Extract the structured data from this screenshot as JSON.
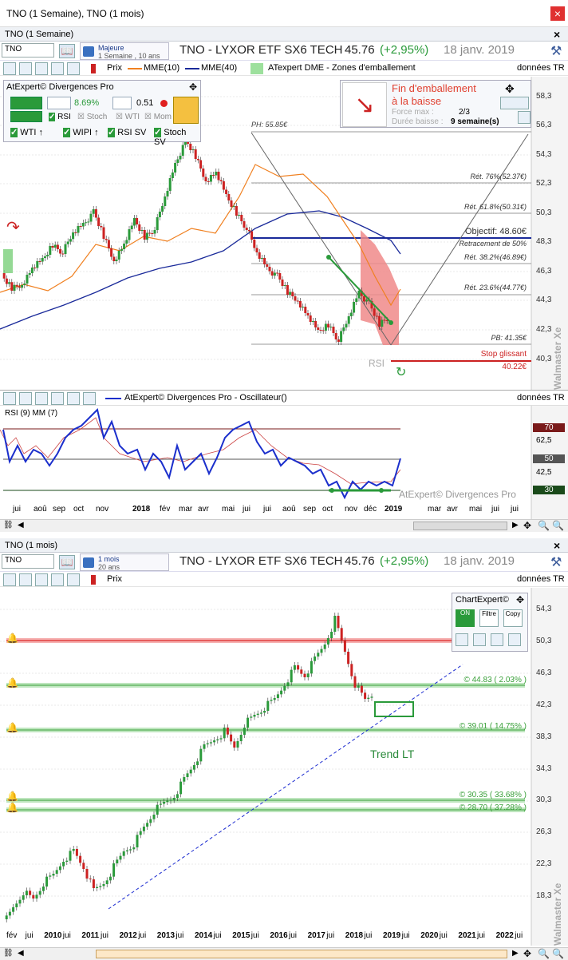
{
  "window": {
    "title": "TNO (1 Semaine), TNO (1 mois)",
    "close": "×"
  },
  "top_panel": {
    "header": "TNO (1 Semaine)",
    "ticker": "TNO",
    "period_top": "Majeure",
    "period_bottom": "1 Semaine , 10 ans",
    "title": "TNO - LYXOR ETF SX6 TECH",
    "price": "45.76",
    "change": "(+2,95%)",
    "date": "18 janv. 2019",
    "data_source": "données TR",
    "legend": [
      "Prix",
      "MME(10)",
      "MME(40)",
      "ATexpert DME - Zones d'emballement"
    ],
    "divergence_box": {
      "title": "AtExpert© Divergences Pro",
      "pct": "8.69%",
      "ratio": "0.51",
      "checks": [
        "RSI",
        "Stoch",
        "WTI",
        "Mom"
      ],
      "signals": [
        "WTI ↑",
        "WIPI ↑",
        "RSI SV",
        "Stoch SV"
      ]
    },
    "emballement_box": {
      "title1": "Fin d'emballement",
      "title2": "à la baisse",
      "force_label": "Force max :",
      "force": "2/3",
      "duree_label": "Durée baisse :",
      "duree": "9 semaine(s)"
    },
    "annotations": {
      "ph": "PH: 55.85€",
      "ret76": "Rét. 76%(52.37€)",
      "ret618": "Rét. 61.8%(50.31€)",
      "objectif": "Objectif: 48.60€",
      "retr50": "Retracement de 50%",
      "ret382": "Rét. 38.2%(46.89€)",
      "ret236": "Rét. 23.6%(44.77€)",
      "pb": "PB: 41.35€",
      "stop_label": "Stop glissant",
      "stop_value": "40.22€",
      "rsi": "RSI",
      "watermark": "Walmaster Xe"
    },
    "yaxis": [
      "58,3",
      "56,3",
      "54,3",
      "52,3",
      "50,3",
      "48,3",
      "46,3",
      "44,3",
      "42,3",
      "40,3"
    ]
  },
  "rsi_panel": {
    "header": "AtExpert© Divergences Pro - Oscillateur()",
    "data_source": "données TR",
    "label": "RSI (9) MM (7)",
    "levels": [
      "70",
      "62,5",
      "50",
      "42,5",
      "30"
    ],
    "watermark": "AtExpert© Divergences Pro",
    "xaxis": [
      "jui",
      "aoû",
      "sep",
      "oct",
      "nov",
      "2018",
      "fév",
      "mar",
      "avr",
      "mai",
      "jui",
      "jui",
      "aoû",
      "sep",
      "oct",
      "nov",
      "déc",
      "2019",
      "mar",
      "avr",
      "mai",
      "jui",
      "jui"
    ]
  },
  "bottom_panel": {
    "header": "TNO (1 mois)",
    "ticker": "TNO",
    "period_top": "1 mois",
    "period_bottom": "20 ans",
    "title": "TNO - LYXOR ETF SX6 TECH",
    "price": "45.76",
    "change": "(+2,95%)",
    "date": "18 janv. 2019",
    "data_source": "données TR",
    "legend": [
      "Prix"
    ],
    "chartexpert": {
      "title": "ChartExpert©",
      "buttons": [
        "ON",
        "Filtre",
        "Copy"
      ]
    },
    "levels": [
      "© 44.83 ( 2.03% )",
      "© 39.01 ( 14.75% )",
      "© 30.35 ( 33.68% )",
      "© 28.70 ( 37.28% )"
    ],
    "trend_label": "Trend LT",
    "watermark": "Walmaster Xe",
    "yaxis": [
      "54,3",
      "50,3",
      "46,3",
      "42,3",
      "38,3",
      "34,3",
      "30,3",
      "26,3",
      "22,3",
      "18,3"
    ],
    "xaxis": [
      "fév",
      "jui",
      "2010",
      "jui",
      "2011",
      "jui",
      "2012",
      "jui",
      "2013",
      "jui",
      "2014",
      "jui",
      "2015",
      "jui",
      "2016",
      "jui",
      "2017",
      "jui",
      "2018",
      "jui",
      "2019",
      "jui",
      "2020",
      "jui",
      "2021",
      "jui",
      "2022",
      "jui"
    ]
  },
  "colors": {
    "bull": "#2a9a3a",
    "bear": "#cc2222",
    "mme10": "#f08020",
    "mme40": "#1a2a9a",
    "rsi": "#1b2fcc",
    "accent": "#cc2222"
  }
}
